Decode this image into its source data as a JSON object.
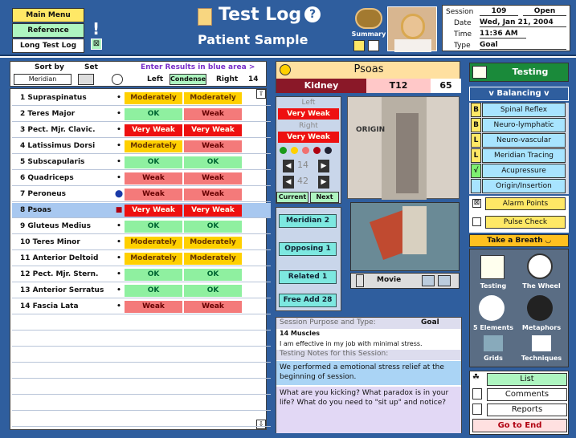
{
  "header": {
    "title": "Test Log",
    "subtitle": "Patient Sample",
    "help": "?",
    "summary": "Summary",
    "menu": [
      "Main Menu",
      "Reference",
      "Long Test Log"
    ],
    "session_label": "Session",
    "session_num": "109",
    "session_status": "Open",
    "date_label": "Date",
    "date": "Wed, Jan 21, 2004",
    "time_label": "Time",
    "time": "11:36 AM",
    "type_label": "Type",
    "type": "Goal"
  },
  "list": {
    "sort_label": "Sort by",
    "set_label": "Set",
    "sort_value": "Meridian",
    "enter_hint": "Enter Results in blue area >",
    "left": "Left",
    "condense": "Condense",
    "right": "Right",
    "count": "14",
    "rows": [
      {
        "n": "1 Supraspinatus",
        "l": "Moderately",
        "r": "Moderately",
        "lc": "md",
        "rc": "md"
      },
      {
        "n": "2 Teres Major",
        "l": "OK",
        "r": "Weak",
        "lc": "ok",
        "rc": "wk"
      },
      {
        "n": "3 Pect. Mjr. Clavic.",
        "l": "Very Weak",
        "r": "Very Weak",
        "lc": "vw",
        "rc": "vw"
      },
      {
        "n": "4 Latissimus Dorsi",
        "l": "Moderately",
        "r": "Weak",
        "lc": "md",
        "rc": "wk"
      },
      {
        "n": "5 Subscapularis",
        "l": "OK",
        "r": "OK",
        "lc": "ok",
        "rc": "ok"
      },
      {
        "n": "6 Quadriceps",
        "l": "Weak",
        "r": "Weak",
        "lc": "wk",
        "rc": "wk"
      },
      {
        "n": "7 Peroneus",
        "l": "Weak",
        "r": "Weak",
        "lc": "wk",
        "rc": "wk"
      },
      {
        "n": "8 Psoas",
        "l": "Very Weak",
        "r": "Very Weak",
        "lc": "vw",
        "rc": "vw"
      },
      {
        "n": "9 Gluteus Medius",
        "l": "OK",
        "r": "OK",
        "lc": "ok",
        "rc": "ok"
      },
      {
        "n": "10 Teres Minor",
        "l": "Moderately",
        "r": "Moderately",
        "lc": "md",
        "rc": "md"
      },
      {
        "n": "11 Anterior Deltoid",
        "l": "Moderately",
        "r": "Moderately",
        "lc": "md",
        "rc": "md"
      },
      {
        "n": "12 Pect. Mjr. Stern.",
        "l": "OK",
        "r": "OK",
        "lc": "ok",
        "rc": "ok"
      },
      {
        "n": "13 Anterior Serratus",
        "l": "OK",
        "r": "OK",
        "lc": "ok",
        "rc": "ok"
      },
      {
        "n": "14 Fascia Lata",
        "l": "Weak",
        "r": "Weak",
        "lc": "wk",
        "rc": "wk"
      }
    ]
  },
  "muscle": {
    "name": "Psoas",
    "organ": "Kidney",
    "vertebra": "T12",
    "number": "65",
    "left_label": "Left",
    "left": "Very Weak",
    "right_label": "Right",
    "right": "Very Weak",
    "n1": "14",
    "n2": "42",
    "current": "Current",
    "next": "Next",
    "origin": "ORIGIN",
    "movie": "Movie"
  },
  "mid_buttons": [
    "Meridian  2",
    "Opposing  1",
    "Related  1",
    "Free Add  28"
  ],
  "notes": {
    "purpose_label": "Session Purpose and Type:",
    "type": "Goal",
    "muscles": "14 Muscles",
    "purpose": "I am effective in my job with minimal stress.",
    "notes_label": "Testing Notes for this Session:",
    "notes": "We performed a emotional stress relief at the beginning of session.",
    "question": "What are you kicking?  What paradox is in your life?  What do you need to \"sit up\" and notice?"
  },
  "right": {
    "testing": "Testing",
    "balancing": "v  Balancing  v",
    "items": [
      {
        "tag": "B",
        "label": "Spinal Reflex"
      },
      {
        "tag": "B",
        "label": "Neuro-lymphatic"
      },
      {
        "tag": "L",
        "label": "Neuro-vascular"
      },
      {
        "tag": "L",
        "label": "Meridian Tracing"
      },
      {
        "tag": "√",
        "label": "Acupressure"
      },
      {
        "tag": "",
        "label": "Origin/Insertion"
      }
    ],
    "alarm": "Alarm Points",
    "pulse": "Pulse Check",
    "breath": "Take a Breath",
    "tiles": [
      "Testing",
      "The Wheel",
      "5 Elements",
      "Metaphors",
      "Grids",
      "Techniques"
    ],
    "bottom": [
      "List",
      "Comments",
      "Reports",
      "Go to End"
    ]
  }
}
